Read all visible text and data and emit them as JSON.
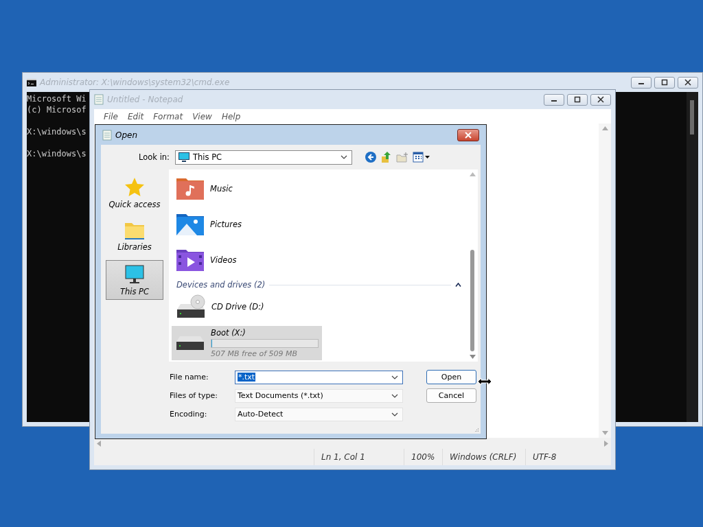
{
  "cmd_window": {
    "title": "Administrator: X:\\windows\\system32\\cmd.exe",
    "paragraphs": [
      [
        "Microsoft Wi",
        "(c) Microsof"
      ],
      [
        "X:\\windows\\s"
      ],
      [
        "X:\\windows\\s"
      ]
    ]
  },
  "notepad": {
    "title": "Untitled - Notepad",
    "menu": [
      "File",
      "Edit",
      "Format",
      "View",
      "Help"
    ],
    "status_bar": [
      "Ln 1, Col 1",
      "100%",
      "Windows (CRLF)",
      "UTF-8"
    ]
  },
  "open_dialog": {
    "title": "Open",
    "look_in": {
      "label": "Look in:",
      "value": "This PC"
    },
    "places": [
      {
        "label": "Quick access",
        "kind": "star",
        "selected": false
      },
      {
        "label": "Libraries",
        "kind": "folder",
        "selected": false
      },
      {
        "label": "This PC",
        "kind": "monitor",
        "selected": true
      }
    ],
    "folders": [
      {
        "name": "Music",
        "kind": "music"
      },
      {
        "name": "Pictures",
        "kind": "pictures"
      },
      {
        "name": "Videos",
        "kind": "videos"
      }
    ],
    "group": {
      "label": "Devices and drives (2)",
      "expanded": true
    },
    "drives": [
      {
        "name": "CD Drive (D:)",
        "kind": "cd",
        "selected": false
      },
      {
        "name": "Boot (X:)",
        "kind": "disk",
        "selected": true,
        "level": 0.004,
        "free": "507 MB free of 509 MB"
      }
    ],
    "fields": [
      {
        "label": "File name:",
        "value": "*.txt",
        "kind": "editable",
        "focused": true
      },
      {
        "label": "Files of type:",
        "value": "Text Documents (*.txt)",
        "kind": "list",
        "focused": false
      },
      {
        "label": "Encoding:",
        "value": "Auto-Detect",
        "kind": "list",
        "focused": false
      }
    ],
    "buttons": [
      {
        "label": "Open",
        "default": true
      },
      {
        "label": "Cancel",
        "default": false
      }
    ]
  }
}
